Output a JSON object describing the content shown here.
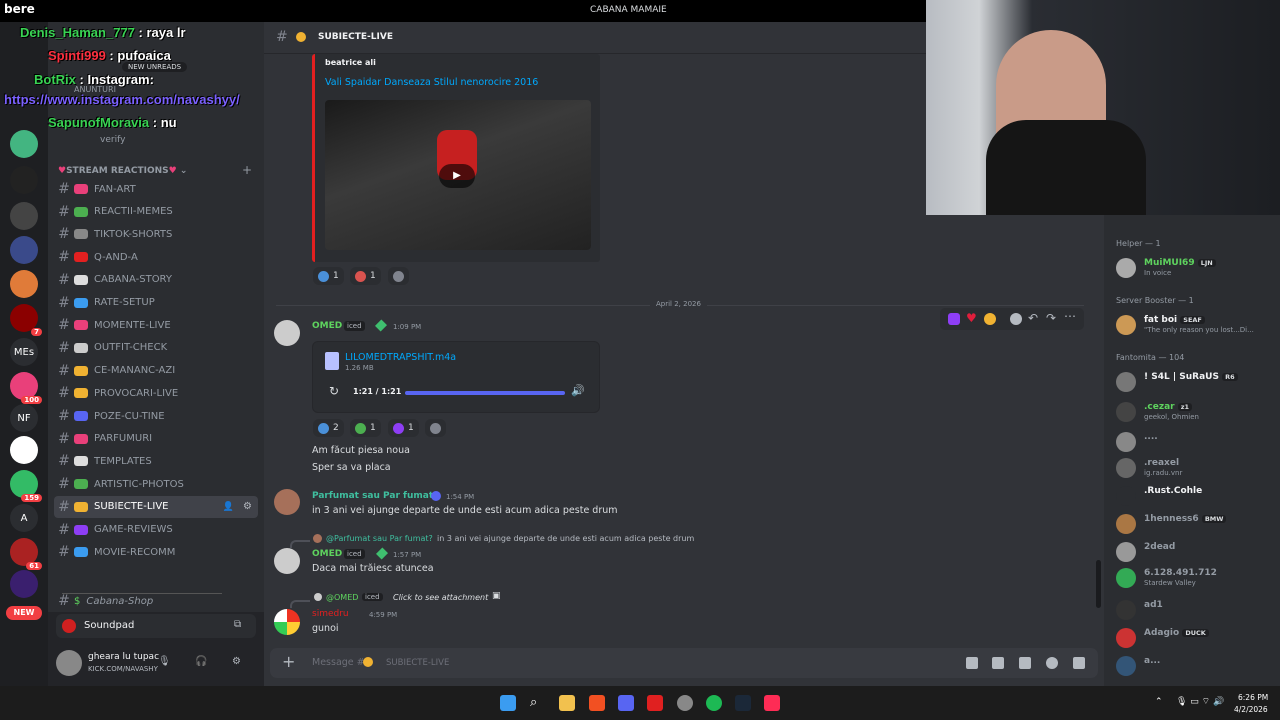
{
  "topbar": {
    "brand": "bere",
    "title": "CABANA MAMAIE"
  },
  "overlay": [
    {
      "user": "Denis_Haman_777",
      "text": ": raya lr",
      "color": "#39d353"
    },
    {
      "user": "Spinti999",
      "text": ": pufoaica",
      "color": "#ff3040"
    },
    {
      "user": "BotRix",
      "text": ": Instagram:",
      "color": "#39d353"
    },
    {
      "user": "",
      "text": "https://www.instagram.com/navashyy/",
      "color": "#7b61ff"
    },
    {
      "user": "SapunofMoravia",
      "text": ": nu",
      "color": "#39d353"
    }
  ],
  "servers": {
    "badges": [
      "7",
      "100",
      "159",
      "61"
    ],
    "labels": [
      "MEs",
      "NF",
      "A",
      "NEW"
    ]
  },
  "sidebar": {
    "new_unreads": "NEW UNREADS",
    "anunturi": "ANUNTURI",
    "verify": "verify",
    "category": "STREAM REACTIONS",
    "channels": [
      "FAN-ART",
      "REACTII-MEMES",
      "TIKTOK-SHORTS",
      "Q-AND-A",
      "CABANA-STORY",
      "RATE-SETUP",
      "MOMENTE-LIVE",
      "OUTFIT-CHECK",
      "CE-MANANC-AZI",
      "PROVOCARI-LIVE",
      "POZE-CU-TINE",
      "PARFUMURI",
      "TEMPLATES",
      "ARTISTIC-PHOTOS",
      "SUBIECTE-LIVE",
      "GAME-REVIEWS",
      "MOVIE-RECOMM"
    ],
    "shop": "Cabana-Shop",
    "soundpad": "Soundpad",
    "user_name": "gheara lu tupac",
    "user_status": "KICK.COM/NAVASHY"
  },
  "channel": {
    "name": "SUBIECTE-LIVE"
  },
  "embed": {
    "author": "beatrice ali",
    "title": "Vali Spaidar Danseaza Stilul nenorocire 2016"
  },
  "embed_reactions": [
    "1",
    "1"
  ],
  "date_divider": "April 2, 2026",
  "messages": [
    {
      "name": "OMED",
      "tag": "iced",
      "time": "1:09 PM",
      "file": "LILOMEDTRAPSHIT.m4a",
      "size": "1.26 MB",
      "player_time": "1:21 / 1:21",
      "reactions": [
        "2",
        "1",
        "1"
      ],
      "lines": [
        "Am făcut piesa noua",
        "Sper sa va placa"
      ]
    },
    {
      "name": "Parfumat sau Par fumat?",
      "time": "1:54 PM",
      "lines": [
        "in 3 ani vei ajunge departe de unde esti acum adica peste drum"
      ]
    },
    {
      "reply": "@Parfumat sau Par fumat?",
      "reply_text": "in 3 ani vei ajunge departe de unde esti acum adica peste drum",
      "name": "OMED",
      "tag": "iced",
      "time": "1:57 PM",
      "lines": [
        "Daca mai trăiesc atuncea"
      ]
    },
    {
      "reply": "@OMED",
      "reply_tag": "iced",
      "reply_text": "Click to see attachment",
      "name": "simedru",
      "time": "4:59 PM",
      "lines": [
        "gunoi"
      ]
    }
  ],
  "composer": {
    "placeholder": "Message #",
    "channel": "SUBIECTE-LIVE"
  },
  "members": {
    "groups": [
      "Helper — 1",
      "Server Booster — 1",
      "Fantomita — 104"
    ],
    "list": [
      {
        "name": "MuiMUI69",
        "tag": "LJN",
        "status": "In voice",
        "color": "#5ed35e"
      },
      {
        "name": "fat boi",
        "tag": "SEAF",
        "status": "\"The only reason you lost...Di...",
        "color": "#f2f3f5"
      },
      {
        "name": "! S4L | SuRaUS",
        "tag": "R6",
        "status": "",
        "color": "#f2f3f5"
      },
      {
        "name": ".cezar",
        "tag": "z1",
        "status": "geekol, Ohmien",
        "color": "#5ed35e"
      },
      {
        "name": "....",
        "tag": "",
        "status": "",
        "color": "#949ba4"
      },
      {
        "name": ".reaxel",
        "tag": "",
        "status": "ig.radu.vnr",
        "color": "#949ba4"
      },
      {
        "name": ".Rust.Cohle",
        "tag": "",
        "status": "",
        "color": "#f2f3f5"
      },
      {
        "name": "1henness6",
        "tag": "BMW",
        "status": "",
        "color": "#949ba4"
      },
      {
        "name": "2dead",
        "tag": "",
        "status": "",
        "color": "#949ba4"
      },
      {
        "name": "6.128.491.712",
        "tag": "",
        "status": "Stardew Valley",
        "color": "#949ba4"
      },
      {
        "name": "ad1",
        "tag": "",
        "status": "",
        "color": "#949ba4"
      },
      {
        "name": "Adagio",
        "tag": "DUCK",
        "status": "",
        "color": "#949ba4"
      },
      {
        "name": "a...",
        "tag": "",
        "status": "",
        "color": "#949ba4"
      }
    ]
  },
  "taskbar": {
    "time": "6:26 PM",
    "date": "4/2/2026"
  }
}
